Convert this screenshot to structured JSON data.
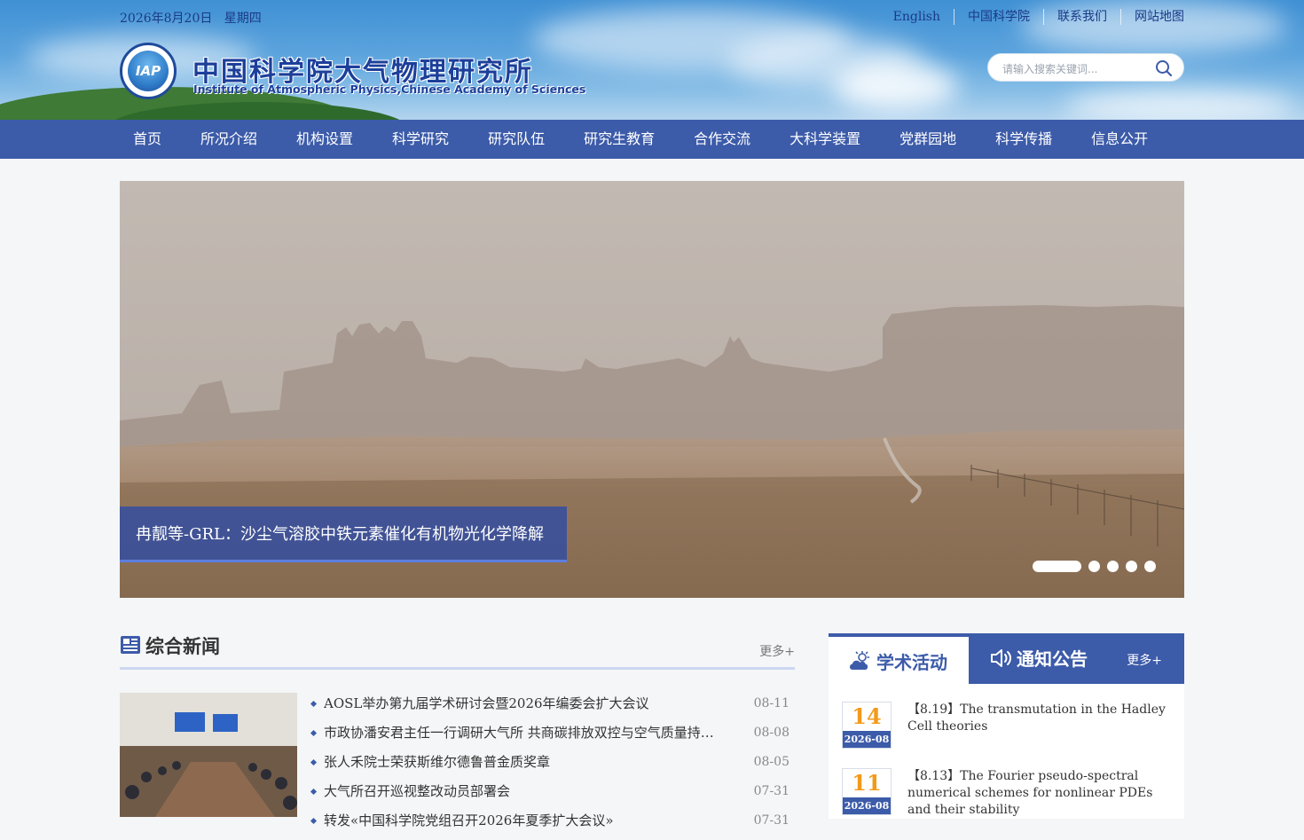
{
  "header": {
    "date": "2026年8月20日",
    "weekday": "星期四",
    "links": [
      "English",
      "中国科学院",
      "联系我们",
      "网站地图"
    ],
    "logo_text": "IAP",
    "site_title_cn": "中国科学院大气物理研究所",
    "site_title_en": "Institute of Atmospheric Physics,Chinese Academy of Sciences",
    "search_placeholder": "请输入搜索关键词..."
  },
  "nav": {
    "items": [
      "首页",
      "所况介绍",
      "机构设置",
      "科学研究",
      "研究队伍",
      "研究生教育",
      "合作交流",
      "大科学装置",
      "党群园地",
      "科学传播",
      "信息公开"
    ]
  },
  "banner": {
    "caption": "冉靓等-GRL：沙尘气溶胶中铁元素催化有机物光化学降解",
    "slide_count": 5,
    "active_slide": 1
  },
  "news": {
    "title": "综合新闻",
    "more": "更多+",
    "items": [
      {
        "title": "AOSL举办第九届学术研讨会暨2026年编委会扩大会议",
        "date": "08-11"
      },
      {
        "title": "市政协潘安君主任一行调研大气所  共商碳排放双控与空气质量持续改善",
        "date": "08-08"
      },
      {
        "title": "张人禾院士荣获斯维尔德鲁普金质奖章",
        "date": "08-05"
      },
      {
        "title": "大气所召开巡视整改动员部署会",
        "date": "07-31"
      },
      {
        "title": "转发«中国科学院党组召开2026年夏季扩大会议»",
        "date": "07-31"
      }
    ]
  },
  "activities": {
    "tab_academic": "学术活动",
    "tab_notice": "通知公告",
    "more": "更多+",
    "items": [
      {
        "day": "14",
        "ym": "2026-08",
        "text": "【8.19】The transmutation in the Hadley Cell theories"
      },
      {
        "day": "11",
        "ym": "2026-08",
        "text": "【8.13】The Fourier pseudo-spectral numerical schemes for nonlinear PDEs and their stability"
      }
    ]
  },
  "colors": {
    "primary_blue": "#3c5ba9",
    "date_orange": "#f29a1b",
    "title_blue": "#1c3f9a"
  }
}
